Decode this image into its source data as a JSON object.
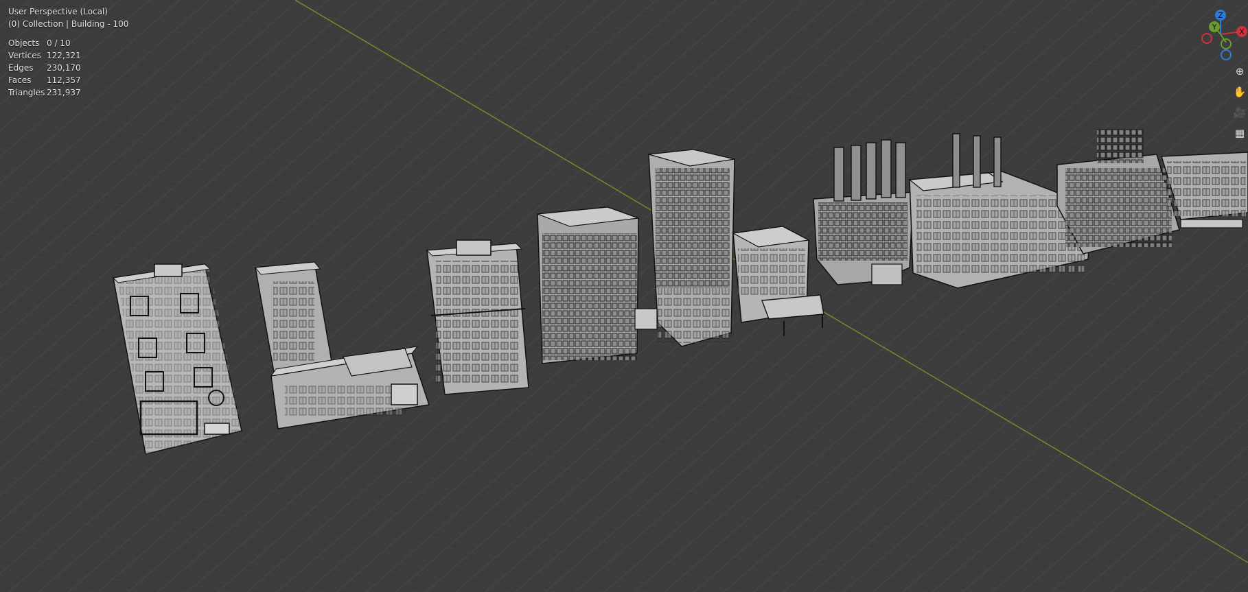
{
  "viewport": {
    "view_name": "User Perspective (Local)",
    "collection_info": "(0) Collection | Building - 100",
    "stats": [
      {
        "label": "Objects",
        "value": "0 / 10"
      },
      {
        "label": "Vertices",
        "value": "122,321"
      },
      {
        "label": "Edges",
        "value": "230,170"
      },
      {
        "label": "Faces",
        "value": "112,357"
      },
      {
        "label": "Triangles",
        "value": "231,937"
      }
    ]
  },
  "gizmo": {
    "axes": [
      {
        "label": "Z",
        "color": "#2e7cd6"
      },
      {
        "label": "Y",
        "color": "#6a9c2f"
      },
      {
        "label": "X",
        "color": "#d0313d"
      }
    ]
  },
  "nav_tools": [
    {
      "name": "zoom-icon",
      "glyph": "⊕"
    },
    {
      "name": "pan-hand-icon",
      "glyph": "✋"
    },
    {
      "name": "camera-icon",
      "glyph": "🎥"
    },
    {
      "name": "perspective-grid-icon",
      "glyph": "▦"
    }
  ],
  "colors": {
    "background": "#3c3c3c",
    "grid_line": "#474747",
    "y_axis_line": "#6b8a2a",
    "building_face": "#b3b3b3",
    "wire": "#111111"
  }
}
